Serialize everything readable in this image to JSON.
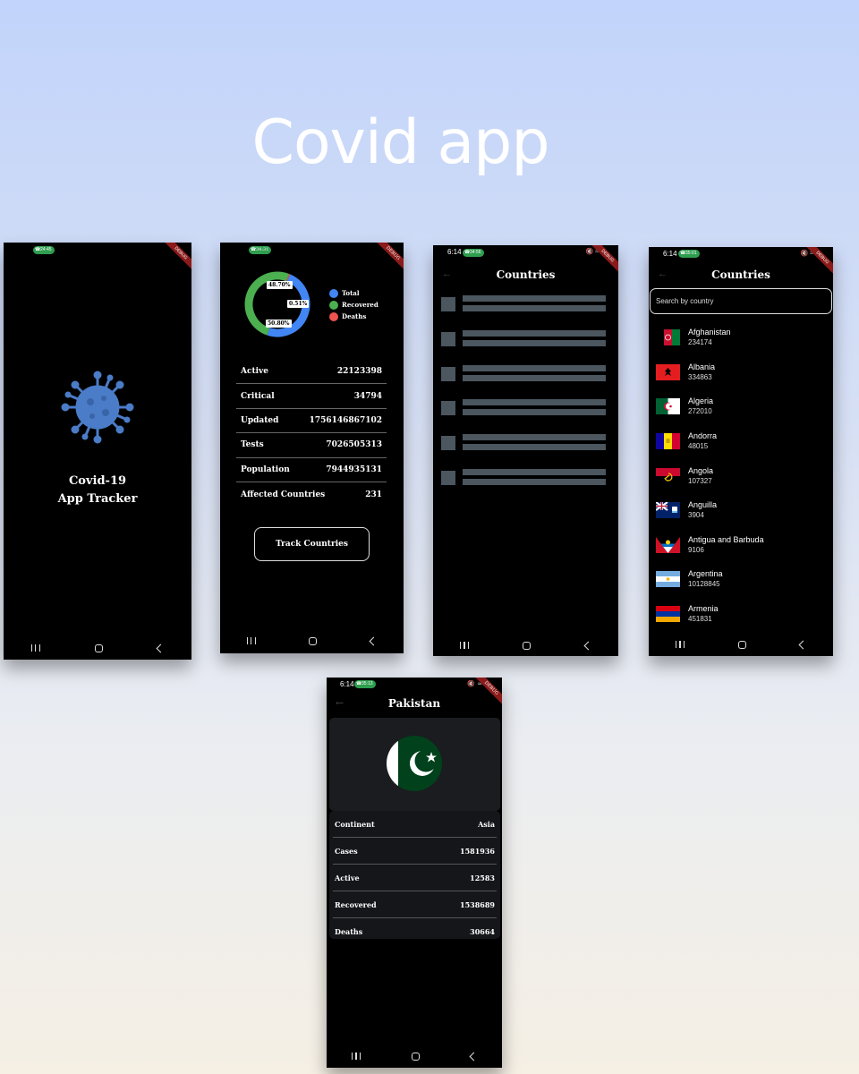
{
  "page": {
    "title": "Covid app"
  },
  "splash": {
    "status_pill": "24:45",
    "debug_label": "DEBUG",
    "line1": "Covid-19",
    "line2": "App Tracker"
  },
  "dashboard": {
    "status_pill": "34:31",
    "debug_label": "DEBUG",
    "chart_data": {
      "type": "pie",
      "variant": "ring",
      "labels": [
        "Total",
        "Recovered",
        "Deaths"
      ],
      "values": [
        48.7,
        50.8,
        0.51
      ],
      "percent_labels": [
        "48.70%",
        "50.80%",
        "0.51%"
      ],
      "colors": [
        "#4285f4",
        "#4caf50",
        "#ef5350"
      ],
      "legend_position": "right"
    },
    "stats": [
      {
        "label": "Active",
        "value": "22123398"
      },
      {
        "label": "Critical",
        "value": "34794"
      },
      {
        "label": "Updated",
        "value": "1756146867102"
      },
      {
        "label": "Tests",
        "value": "7026505313"
      },
      {
        "label": "Population",
        "value": "7944935131"
      },
      {
        "label": "Affected Countries",
        "value": "231"
      }
    ],
    "button_label": "Track Countries"
  },
  "loading": {
    "time": "6:14",
    "status_pill": "34:56",
    "debug_label": "DEBUG",
    "title": "Countries",
    "skeleton_rows": 6
  },
  "countries": {
    "time": "6:14",
    "status_pill": "35:01",
    "debug_label": "DEBUG",
    "title": "Countries",
    "search_placeholder": "Search by country",
    "items": [
      {
        "name": "Afghanistan",
        "count": "234174",
        "flag": "af"
      },
      {
        "name": "Albania",
        "count": "334863",
        "flag": "al"
      },
      {
        "name": "Algeria",
        "count": "272010",
        "flag": "dz"
      },
      {
        "name": "Andorra",
        "count": "48015",
        "flag": "ad"
      },
      {
        "name": "Angola",
        "count": "107327",
        "flag": "ao"
      },
      {
        "name": "Anguilla",
        "count": "3904",
        "flag": "ai"
      },
      {
        "name": "Antigua and Barbuda",
        "count": "9106",
        "flag": "ag"
      },
      {
        "name": "Argentina",
        "count": "10128845",
        "flag": "ar"
      },
      {
        "name": "Armenia",
        "count": "451831",
        "flag": "am"
      }
    ]
  },
  "detail": {
    "time": "6:14",
    "status_pill": "35:13",
    "debug_label": "DEBUG",
    "title": "Pakistan",
    "rows": [
      {
        "label": "Continent",
        "value": "Asia"
      },
      {
        "label": "Cases",
        "value": "1581936"
      },
      {
        "label": "Active",
        "value": "12583"
      },
      {
        "label": "Recovered",
        "value": "1538689"
      },
      {
        "label": "Deaths",
        "value": "30664"
      }
    ]
  },
  "colors": {
    "accent_green": "#2e9e4f",
    "skeleton": "#4b565f",
    "virus": "#4a7cc7"
  }
}
